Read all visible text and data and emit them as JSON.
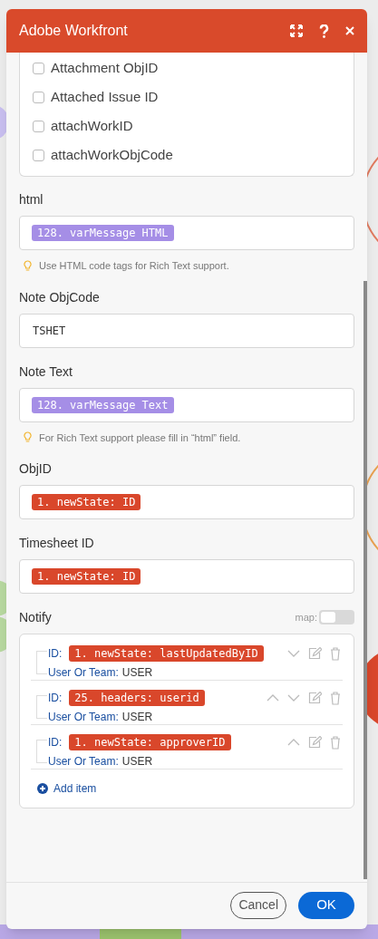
{
  "window": {
    "title": "Adobe Workfront"
  },
  "checkbox_options": [
    {
      "label": "Attachment ObjID",
      "checked": false
    },
    {
      "label": "Attached Issue ID",
      "checked": false
    },
    {
      "label": "attachWorkID",
      "checked": false
    },
    {
      "label": "attachWorkObjCode",
      "checked": false
    }
  ],
  "fields": [
    {
      "label": "html",
      "value": {
        "kind": "tag",
        "text": "128. varMessage HTML",
        "color": "#a58ee6"
      },
      "hint": "Use HTML code tags for Rich Text support."
    },
    {
      "label": "Note ObjCode",
      "value": {
        "kind": "text",
        "text": "TSHET"
      }
    },
    {
      "label": "Note Text",
      "value": {
        "kind": "tag",
        "text": "128. varMessage Text",
        "color": "#a58ee6"
      },
      "hint": "For Rich Text support please fill in “html” field."
    },
    {
      "label": "ObjID",
      "value": {
        "kind": "tag",
        "text": "1. newState: ID",
        "color": "#d9472b"
      }
    },
    {
      "label": "Timesheet ID",
      "value": {
        "kind": "tag",
        "text": "1. newState: ID",
        "color": "#d9472b"
      }
    }
  ],
  "notify": {
    "label": "Notify",
    "map_label": "map:",
    "map_on": false,
    "items": [
      {
        "id_label": "ID:",
        "id_tag": "1. newState: lastUpdatedByID",
        "color": "#d9472b",
        "type_label": "User Or Team:",
        "type_value": "USER",
        "can_move_up": false,
        "can_move_down": true
      },
      {
        "id_label": "ID:",
        "id_tag": "25. headers: userid",
        "color": "#d9472b",
        "type_label": "User Or Team:",
        "type_value": "USER",
        "can_move_up": true,
        "can_move_down": true
      },
      {
        "id_label": "ID:",
        "id_tag": "1. newState: approverID",
        "color": "#d9472b",
        "type_label": "User Or Team:",
        "type_value": "USER",
        "can_move_up": true,
        "can_move_down": false
      }
    ],
    "add_label": "Add item"
  },
  "buttons": {
    "cancel": "Cancel",
    "ok": "OK"
  }
}
